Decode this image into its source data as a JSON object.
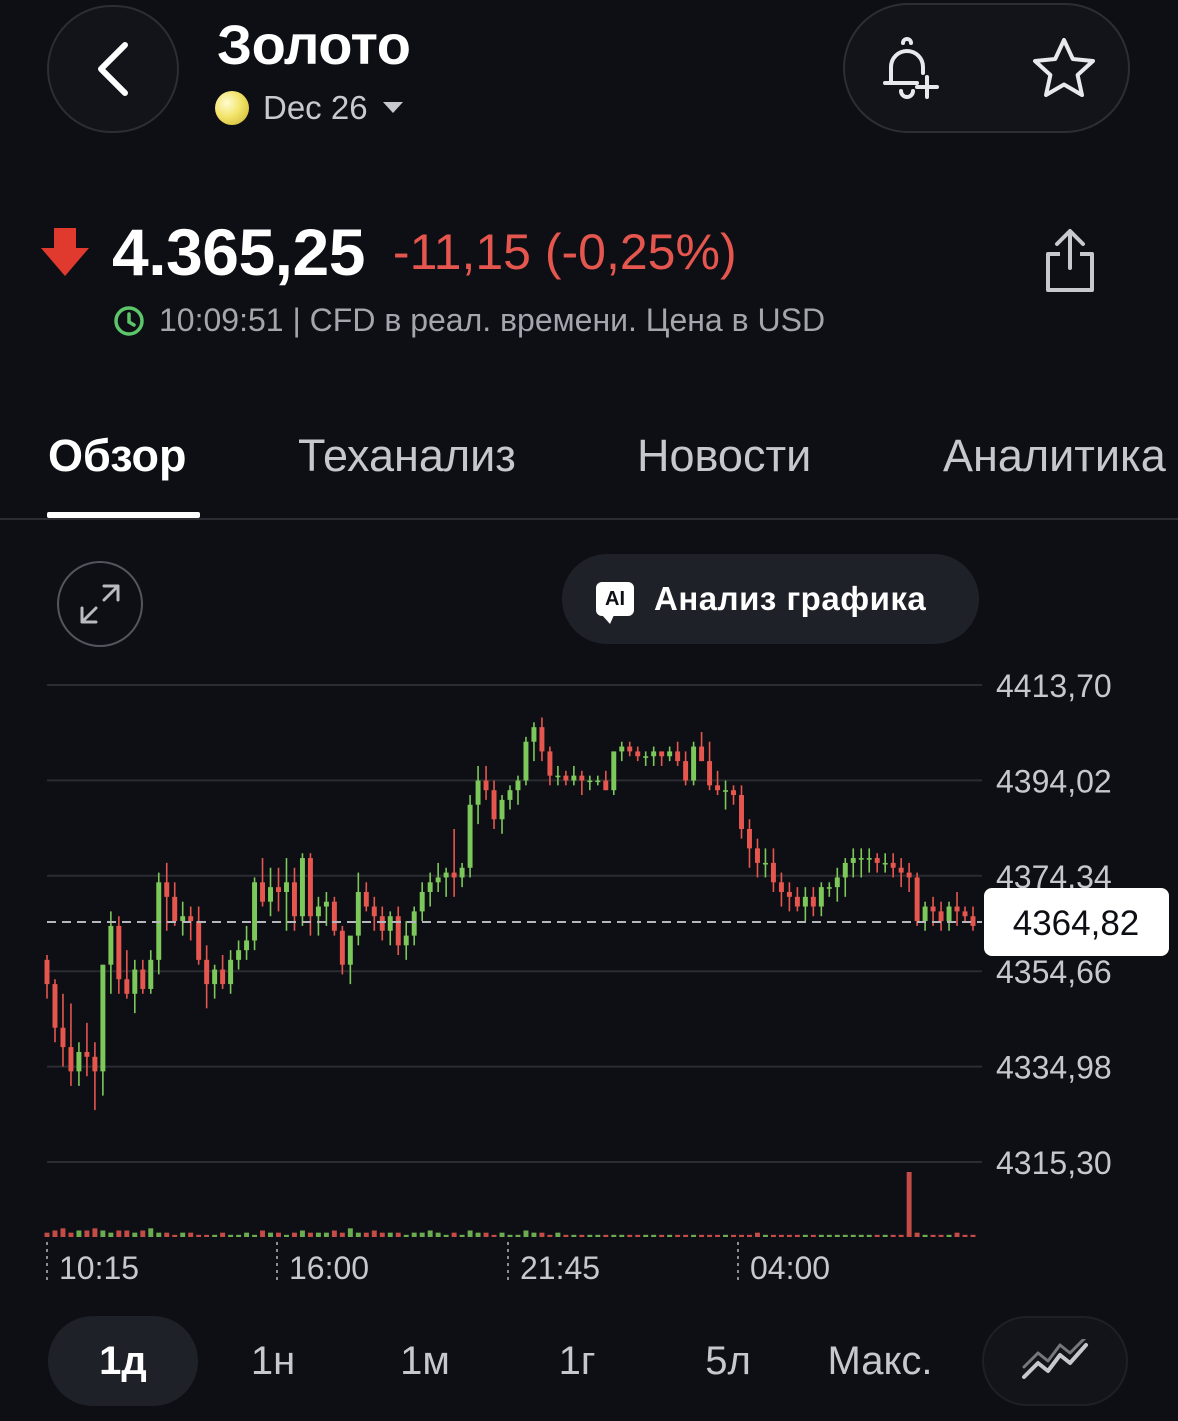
{
  "header": {
    "title": "Золото",
    "contract": "Dec 26",
    "icons": {
      "back": "chevron-left-icon",
      "alert": "bell-plus-icon",
      "watchlist": "star-icon"
    }
  },
  "quote": {
    "direction": "down",
    "price": "4.365,25",
    "change": "-11,15 (-0,25%)",
    "time_info": "10:09:51 | CFD в реал. времени. Цена в USD",
    "colors": {
      "down": "#e5564f",
      "up": "#7cc85a",
      "clock": "#5cc66a"
    }
  },
  "tabs": [
    {
      "label": "Обзор",
      "active": true
    },
    {
      "label": "Теханализ",
      "active": false
    },
    {
      "label": "Новости",
      "active": false
    },
    {
      "label": "Аналитика",
      "active": false
    }
  ],
  "toolbar": {
    "ai_badge": "AI",
    "ai_label": "Анализ графика"
  },
  "chart_data": {
    "type": "candlestick",
    "y_ticks": [
      "4413,70",
      "4394,02",
      "4374,34",
      "4354,66",
      "4334,98",
      "4315,30"
    ],
    "y_tick_values": [
      4413.7,
      4394.02,
      4374.34,
      4354.66,
      4334.98,
      4315.3
    ],
    "x_ticks": [
      "10:15",
      "16:00",
      "21:45",
      "04:00"
    ],
    "current_price": 4364.82,
    "current_price_label": "4364,82",
    "ylim": [
      4315.3,
      4413.7
    ],
    "grid": true,
    "colors": {
      "up": "#7cc85a",
      "down": "#e5564f",
      "grid": "#2a2c31"
    },
    "candles": [
      [
        4357,
        4358,
        4349,
        4352
      ],
      [
        4352,
        4353,
        4340,
        4343
      ],
      [
        4343,
        4350,
        4335,
        4339
      ],
      [
        4339,
        4348,
        4331,
        4334
      ],
      [
        4334,
        4340,
        4331,
        4338
      ],
      [
        4338,
        4344,
        4333,
        4337
      ],
      [
        4337,
        4340,
        4326,
        4334
      ],
      [
        4334,
        4356,
        4329,
        4356
      ],
      [
        4356,
        4367,
        4350,
        4364
      ],
      [
        4364,
        4366,
        4350,
        4353
      ],
      [
        4353,
        4359,
        4349,
        4350
      ],
      [
        4350,
        4357,
        4346,
        4355
      ],
      [
        4355,
        4357,
        4350,
        4351
      ],
      [
        4351,
        4359,
        4350,
        4357
      ],
      [
        4357,
        4375,
        4354,
        4373
      ],
      [
        4373,
        4377,
        4363,
        4370
      ],
      [
        4370,
        4373,
        4364,
        4365
      ],
      [
        4365,
        4369,
        4362,
        4366
      ],
      [
        4366,
        4368,
        4361,
        4365
      ],
      [
        4365,
        4368,
        4356,
        4357
      ],
      [
        4357,
        4360,
        4347,
        4352
      ],
      [
        4352,
        4356,
        4349,
        4355
      ],
      [
        4355,
        4358,
        4351,
        4352
      ],
      [
        4352,
        4359,
        4350,
        4357
      ],
      [
        4357,
        4361,
        4355,
        4359
      ],
      [
        4359,
        4364,
        4357,
        4361
      ],
      [
        4361,
        4374,
        4359,
        4373
      ],
      [
        4373,
        4378,
        4368,
        4369
      ],
      [
        4369,
        4376,
        4366,
        4372
      ],
      [
        4372,
        4376,
        4367,
        4371
      ],
      [
        4371,
        4378,
        4363,
        4373
      ],
      [
        4373,
        4376,
        4363,
        4366
      ],
      [
        4366,
        4379,
        4364,
        4378
      ],
      [
        4378,
        4379,
        4362,
        4366
      ],
      [
        4366,
        4370,
        4362,
        4368
      ],
      [
        4368,
        4371,
        4364,
        4369
      ],
      [
        4369,
        4370,
        4362,
        4363
      ],
      [
        4363,
        4364,
        4354,
        4356
      ],
      [
        4356,
        4361,
        4352,
        4362
      ],
      [
        4362,
        4375,
        4360,
        4371
      ],
      [
        4371,
        4373,
        4367,
        4368
      ],
      [
        4368,
        4370,
        4363,
        4366
      ],
      [
        4366,
        4368,
        4361,
        4363
      ],
      [
        4363,
        4367,
        4360,
        4366
      ],
      [
        4366,
        4368,
        4358,
        4360
      ],
      [
        4360,
        4365,
        4357,
        4362
      ],
      [
        4362,
        4368,
        4360,
        4367
      ],
      [
        4367,
        4373,
        4365,
        4371
      ],
      [
        4371,
        4375,
        4368,
        4373
      ],
      [
        4373,
        4377,
        4371,
        4374
      ],
      [
        4374,
        4376,
        4370,
        4375
      ],
      [
        4375,
        4384,
        4370,
        4374
      ],
      [
        4374,
        4377,
        4372,
        4376
      ],
      [
        4376,
        4391,
        4374,
        4389
      ],
      [
        4389,
        4397,
        4385,
        4394
      ],
      [
        4394,
        4397,
        4390,
        4392
      ],
      [
        4392,
        4394,
        4384,
        4386
      ],
      [
        4386,
        4391,
        4383,
        4390
      ],
      [
        4390,
        4393,
        4388,
        4392
      ],
      [
        4392,
        4395,
        4389,
        4394
      ],
      [
        4394,
        4403,
        4393,
        4402
      ],
      [
        4402,
        4406,
        4398,
        4405
      ],
      [
        4405,
        4407,
        4398,
        4400
      ],
      [
        4400,
        4401,
        4393,
        4395
      ],
      [
        4395,
        4397,
        4393,
        4395
      ],
      [
        4395,
        4396,
        4393,
        4394
      ],
      [
        4394,
        4397,
        4393,
        4395
      ],
      [
        4395,
        4396,
        4391,
        4394
      ],
      [
        4394,
        4395,
        4392,
        4394
      ],
      [
        4394,
        4395,
        4393,
        4394
      ],
      [
        4394,
        4396,
        4392,
        4392
      ],
      [
        4392,
        4400,
        4391,
        4400
      ],
      [
        4400,
        4402,
        4398,
        4401
      ],
      [
        4401,
        4402,
        4399,
        4400
      ],
      [
        4400,
        4401,
        4398,
        4399
      ],
      [
        4399,
        4400,
        4397,
        4399
      ],
      [
        4399,
        4401,
        4397,
        4400
      ],
      [
        4400,
        4400,
        4397,
        4399
      ],
      [
        4399,
        4401,
        4398,
        4400
      ],
      [
        4400,
        4402,
        4397,
        4398
      ],
      [
        4398,
        4400,
        4393,
        4394
      ],
      [
        4394,
        4402,
        4393,
        4401
      ],
      [
        4401,
        4404,
        4398,
        4398
      ],
      [
        4398,
        4402,
        4392,
        4393
      ],
      [
        4393,
        4396,
        4391,
        4392
      ],
      [
        4392,
        4394,
        4388,
        4392
      ],
      [
        4392,
        4393,
        4389,
        4391
      ],
      [
        4391,
        4393,
        4382,
        4384
      ],
      [
        4384,
        4386,
        4376,
        4380
      ],
      [
        4380,
        4382,
        4374,
        4377
      ],
      [
        4377,
        4380,
        4374,
        4377
      ],
      [
        4377,
        4380,
        4371,
        4373
      ],
      [
        4373,
        4375,
        4368,
        4371
      ],
      [
        4371,
        4373,
        4367,
        4370
      ],
      [
        4370,
        4372,
        4367,
        4368
      ],
      [
        4368,
        4372,
        4365,
        4370
      ],
      [
        4370,
        4372,
        4366,
        4368
      ],
      [
        4368,
        4373,
        4366,
        4372
      ],
      [
        4372,
        4373,
        4370,
        4372
      ],
      [
        4372,
        4376,
        4369,
        4374
      ],
      [
        4374,
        4378,
        4370,
        4377
      ],
      [
        4377,
        4380,
        4374,
        4378
      ],
      [
        4378,
        4380,
        4374,
        4378
      ],
      [
        4378,
        4380,
        4375,
        4378
      ],
      [
        4378,
        4379,
        4375,
        4377
      ],
      [
        4377,
        4379,
        4375,
        4377
      ],
      [
        4377,
        4379,
        4374,
        4376
      ],
      [
        4376,
        4378,
        4372,
        4375
      ],
      [
        4375,
        4377,
        4371,
        4374
      ],
      [
        4374,
        4375,
        4364,
        4365
      ],
      [
        4365,
        4369,
        4363,
        4368
      ],
      [
        4368,
        4370,
        4364,
        4367
      ],
      [
        4367,
        4369,
        4363,
        4365
      ],
      [
        4365,
        4369,
        4363,
        4368
      ],
      [
        4368,
        4371,
        4364,
        4367
      ],
      [
        4367,
        4368,
        4365,
        4366
      ],
      [
        4366,
        4368,
        4363,
        4364
      ]
    ],
    "volumes": [
      2,
      3,
      4,
      2,
      3,
      3,
      4,
      3,
      2,
      3,
      3,
      2,
      3,
      4,
      2,
      2,
      1,
      2,
      2,
      1,
      1,
      1,
      2,
      1,
      1,
      2,
      1,
      3,
      2,
      2,
      1,
      2,
      3,
      2,
      2,
      2,
      3,
      2,
      4,
      2,
      2,
      3,
      2,
      2,
      2,
      1,
      2,
      2,
      3,
      2,
      1,
      2,
      1,
      3,
      2,
      2,
      1,
      2,
      1,
      1,
      3,
      2,
      2,
      1,
      2,
      1,
      1,
      1,
      1,
      1,
      1,
      1,
      1,
      1,
      1,
      1,
      1,
      1,
      1,
      1,
      1,
      1,
      1,
      1,
      1,
      1,
      1,
      1,
      1,
      2,
      1,
      1,
      1,
      1,
      1,
      1,
      1,
      1,
      1,
      1,
      1,
      1,
      1,
      1,
      1,
      1,
      1,
      1,
      30,
      2,
      1,
      1,
      1,
      1,
      2,
      1,
      1
    ]
  },
  "periods": [
    {
      "label": "1д",
      "active": true
    },
    {
      "label": "1н",
      "active": false
    },
    {
      "label": "1м",
      "active": false
    },
    {
      "label": "1г",
      "active": false
    },
    {
      "label": "5л",
      "active": false
    },
    {
      "label": "Макс.",
      "active": false
    }
  ]
}
